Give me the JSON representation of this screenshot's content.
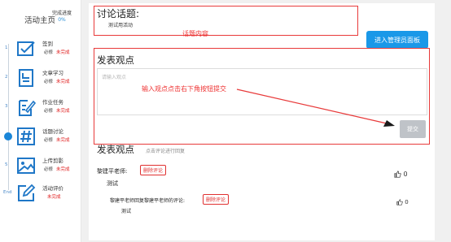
{
  "sidebar": {
    "title": "活动主页",
    "progress_label": "完成进度",
    "progress_value": "0%",
    "steps": [
      {
        "num": "1",
        "name": "签到",
        "req": "必修",
        "status": "未完成",
        "icon": "checkbox-icon"
      },
      {
        "num": "2",
        "name": "文章学习",
        "req": "必修",
        "status": "未完成",
        "icon": "document-icon"
      },
      {
        "num": "3",
        "name": "作业任务",
        "req": "必修",
        "status": "未完成",
        "icon": "assignment-icon"
      },
      {
        "num": "",
        "name": "话题讨论",
        "req": "必修",
        "status": "未完成",
        "icon": "hashtag-icon",
        "current": true
      },
      {
        "num": "5",
        "name": "上传剪影",
        "req": "必修",
        "status": "未完成",
        "icon": "image-icon"
      },
      {
        "num": "End",
        "name": "活动评价",
        "req": "",
        "status": "未完成",
        "icon": "edit-icon"
      }
    ]
  },
  "topic": {
    "title": "讨论话题:",
    "content": "测试用活动",
    "annotation": "话题内容"
  },
  "admin_button": "进入管理员面板",
  "post": {
    "title": "发表观点",
    "placeholder": "请输入观点",
    "annotation": "输入观点点击右下角按钮提交",
    "submit": "提交"
  },
  "comments_section": {
    "title": "发表观点",
    "hint": "点击评论进行回复",
    "delete_label": "删除评论",
    "items": [
      {
        "author": "黎建平老师:",
        "text": "测试",
        "likes": "0"
      },
      {
        "author": "黎建平老师回复黎建平老师的评论:",
        "text": "测试",
        "likes": "0"
      }
    ]
  },
  "colors": {
    "accent": "#1a98e8",
    "annotation": "#e83a3a",
    "status": "#e02020"
  }
}
